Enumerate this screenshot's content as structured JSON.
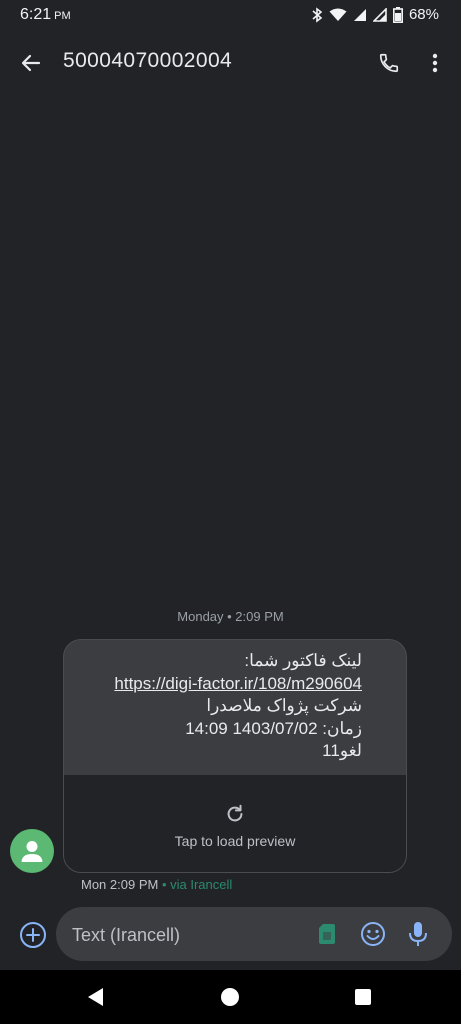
{
  "status": {
    "time": "6:21",
    "ampm": "PM",
    "battery": "68%"
  },
  "header": {
    "title": "50004070002004"
  },
  "conversation": {
    "date_separator": "Monday • 2:09 PM",
    "message": {
      "lines": [
        "لینک فاکتور شما:",
        "https://digi-factor.ir/108/m290604",
        "شرکت پژواک ملاصدرا",
        "زمان: 1403/07/02 14:09",
        "لغو11"
      ],
      "preview_label": "Tap to load preview",
      "timestamp": "Mon 2:09 PM",
      "via": "• via Irancell"
    }
  },
  "composer": {
    "placeholder": "Text (Irancell)"
  },
  "icons": {
    "back": "back-arrow-icon",
    "call": "phone-icon",
    "more": "more-vert-icon",
    "add": "add-circle-icon",
    "sim": "sim-card-icon",
    "emoji": "emoji-icon",
    "mic": "mic-icon",
    "refresh": "refresh-icon",
    "avatar": "person-icon"
  },
  "colors": {
    "background": "#212327",
    "bubble": "#3c3d40",
    "avatar": "#5bb974",
    "accent": "#8ab4f8",
    "via": "#2c8a6e"
  }
}
